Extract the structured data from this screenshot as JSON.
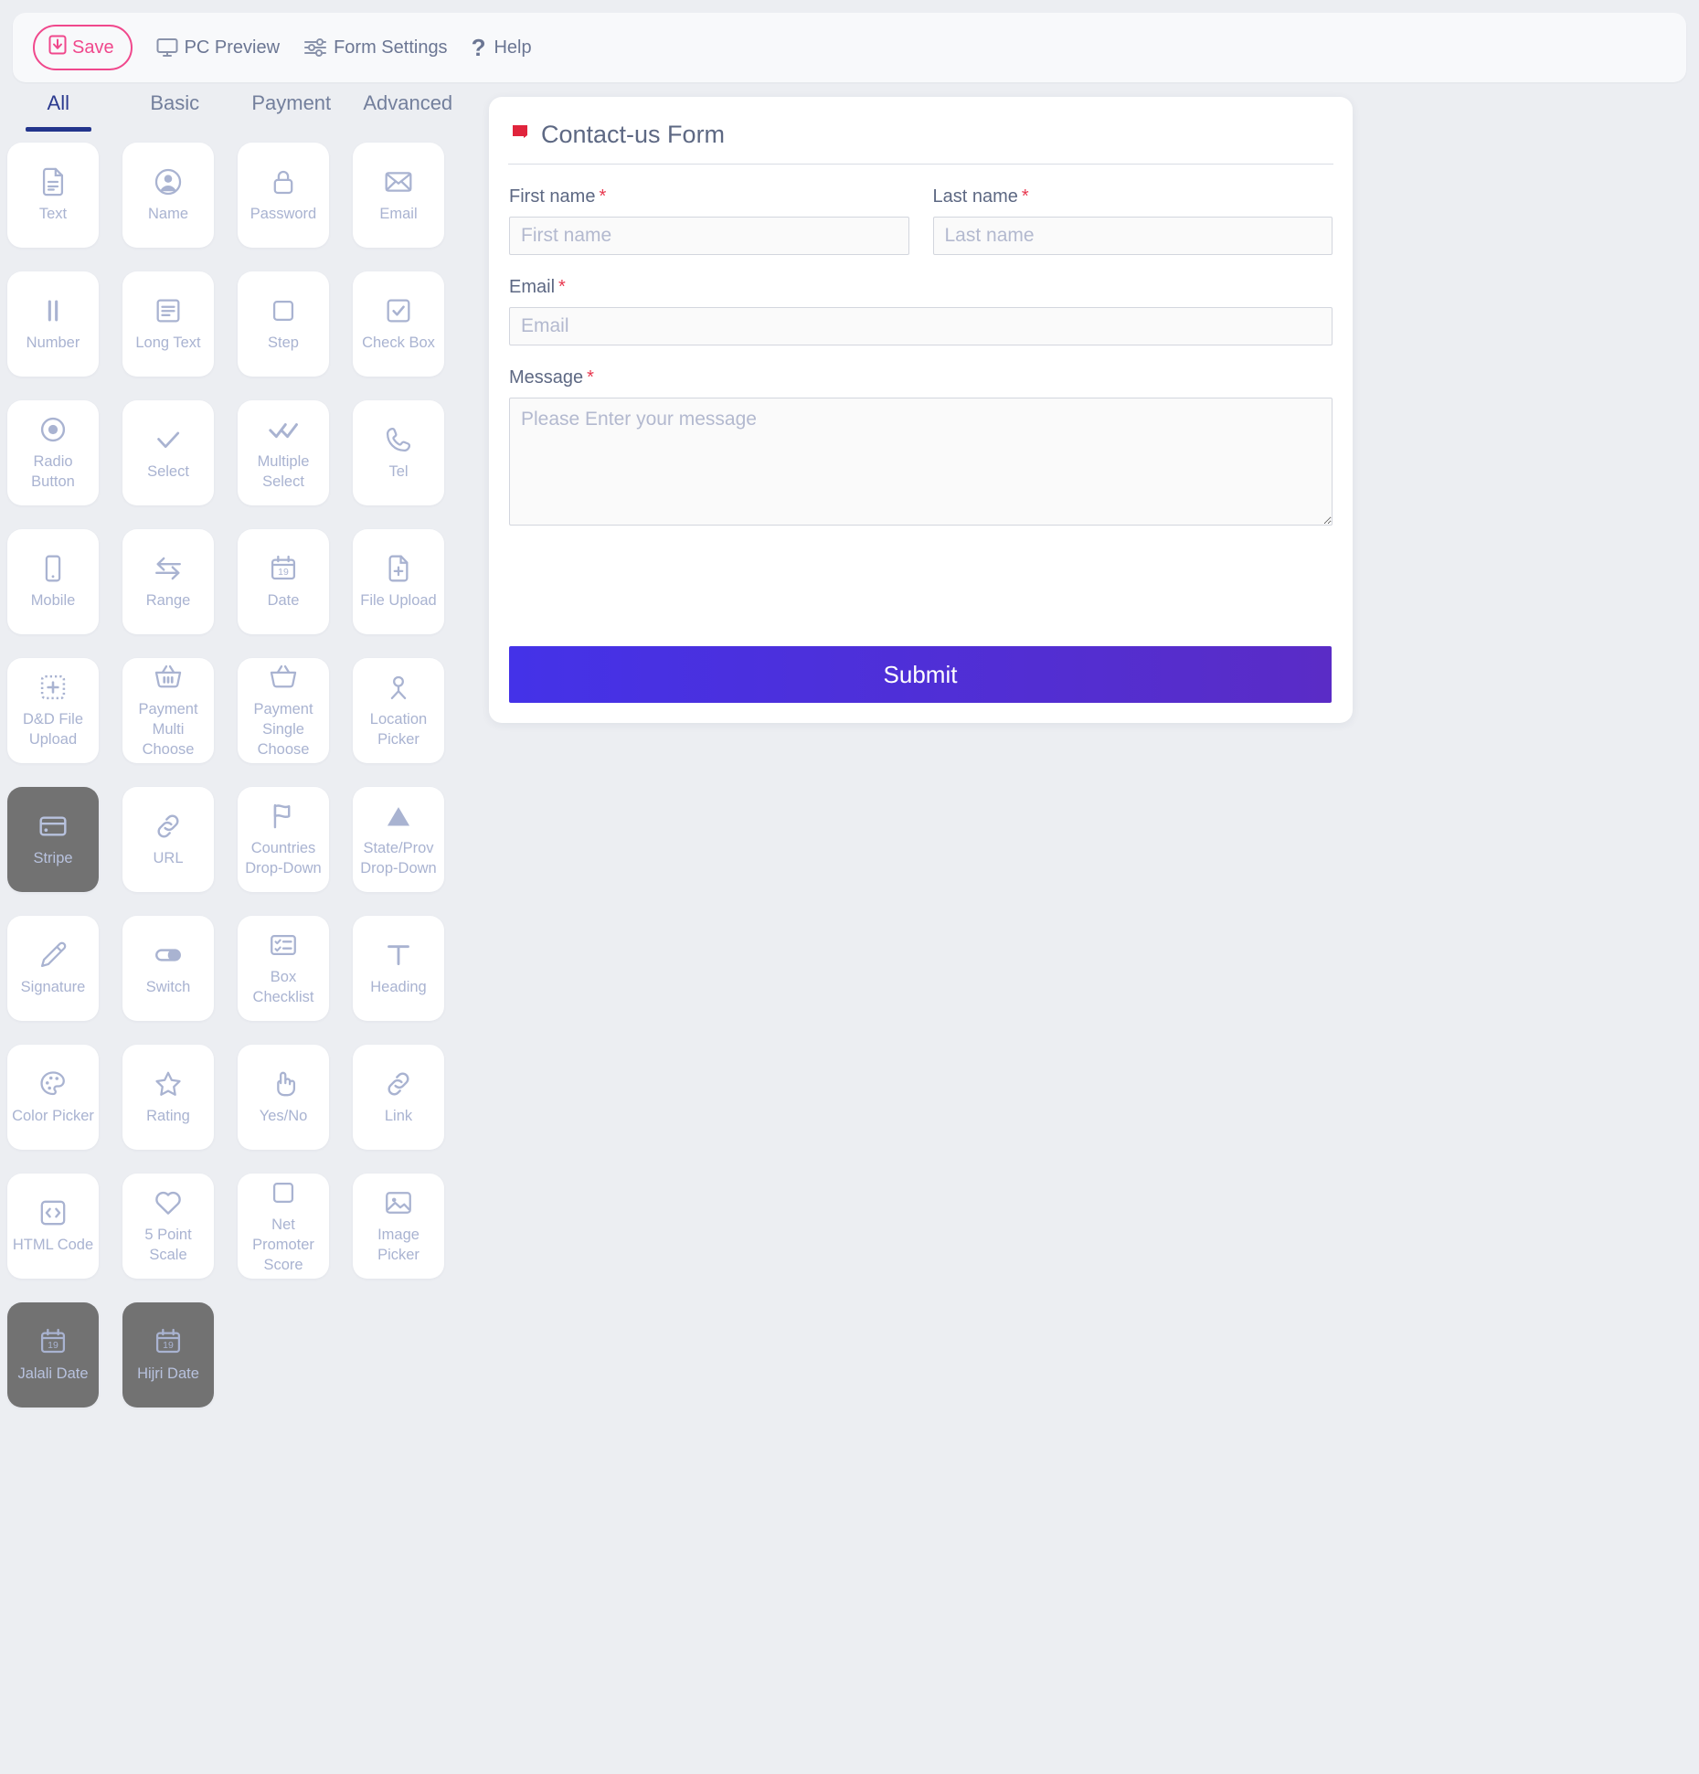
{
  "toolbar": {
    "save_label": "Save",
    "pc_preview_label": "PC Preview",
    "form_settings_label": "Form Settings",
    "help_label": "Help",
    "save_color": "#f0488c",
    "text_color": "#6b7693"
  },
  "tabs": {
    "active": "All",
    "accent": "#23358c",
    "items": [
      {
        "label": "All"
      },
      {
        "label": "Basic"
      },
      {
        "label": "Payment"
      },
      {
        "label": "Advanced"
      }
    ]
  },
  "palette": {
    "items": [
      {
        "label": "Text",
        "icon": "document-icon",
        "state": "normal"
      },
      {
        "label": "Name",
        "icon": "user-circle-icon",
        "state": "normal"
      },
      {
        "label": "Password",
        "icon": "lock-icon",
        "state": "normal"
      },
      {
        "label": "Email",
        "icon": "envelope-icon",
        "state": "normal"
      },
      {
        "label": "Number",
        "icon": "number-bars-icon",
        "state": "normal"
      },
      {
        "label": "Long Text",
        "icon": "text-lines-icon",
        "state": "normal"
      },
      {
        "label": "Step",
        "icon": "square-outline-icon",
        "state": "normal"
      },
      {
        "label": "Check Box",
        "icon": "checkbox-checked-icon",
        "state": "normal"
      },
      {
        "label": "Radio Button",
        "icon": "radio-button-icon",
        "state": "normal"
      },
      {
        "label": "Select",
        "icon": "check-icon",
        "state": "normal"
      },
      {
        "label": "Multiple Select",
        "icon": "double-check-icon",
        "state": "normal"
      },
      {
        "label": "Tel",
        "icon": "phone-icon",
        "state": "normal"
      },
      {
        "label": "Mobile",
        "icon": "mobile-phone-icon",
        "state": "normal"
      },
      {
        "label": "Range",
        "icon": "arrows-left-right-icon",
        "state": "normal"
      },
      {
        "label": "Date",
        "icon": "calendar-19-icon",
        "state": "normal"
      },
      {
        "label": "File Upload",
        "icon": "file-plus-icon",
        "state": "normal"
      },
      {
        "label": "D&D File Upload",
        "icon": "dashed-plus-icon",
        "state": "normal"
      },
      {
        "label": "Payment Multi Choose",
        "icon": "basket-filled-icon",
        "state": "normal"
      },
      {
        "label": "Payment Single Choose",
        "icon": "basket-empty-icon",
        "state": "normal"
      },
      {
        "label": "Location Picker",
        "icon": "location-pin-icon",
        "state": "normal"
      },
      {
        "label": "Stripe",
        "icon": "credit-card-icon",
        "state": "dark"
      },
      {
        "label": "URL",
        "icon": "link-chain-icon",
        "state": "normal"
      },
      {
        "label": "Countries Drop-Down",
        "icon": "flag-icon",
        "state": "normal"
      },
      {
        "label": "State/Prov Drop-Down",
        "icon": "triangle-icon",
        "state": "normal"
      },
      {
        "label": "Signature",
        "icon": "pen-icon",
        "state": "normal"
      },
      {
        "label": "Switch",
        "icon": "toggle-switch-icon",
        "state": "normal"
      },
      {
        "label": "Box Checklist",
        "icon": "checklist-box-icon",
        "state": "normal"
      },
      {
        "label": "Heading",
        "icon": "letter-t-icon",
        "state": "normal"
      },
      {
        "label": "Color Picker",
        "icon": "palette-icon",
        "state": "normal"
      },
      {
        "label": "Rating",
        "icon": "star-outline-icon",
        "state": "normal"
      },
      {
        "label": "Yes/No",
        "icon": "pointing-hand-icon",
        "state": "normal"
      },
      {
        "label": "Link",
        "icon": "link-chain-icon",
        "state": "normal"
      },
      {
        "label": "HTML Code",
        "icon": "code-brackets-icon",
        "state": "normal"
      },
      {
        "label": "5 Point Scale",
        "icon": "heart-outline-icon",
        "state": "normal"
      },
      {
        "label": "Net Promoter Score",
        "icon": "square-outline-icon",
        "state": "normal"
      },
      {
        "label": "Image Picker",
        "icon": "image-icon",
        "state": "normal"
      },
      {
        "label": "Jalali Date",
        "icon": "calendar-19-icon",
        "state": "dark"
      },
      {
        "label": "Hijri Date",
        "icon": "calendar-19-icon",
        "state": "dark"
      }
    ]
  },
  "form": {
    "title": "Contact-us Form",
    "title_icon": "red-flag-icon",
    "required_mark": "*",
    "fields": {
      "first_name": {
        "label": "First name",
        "placeholder": "First name",
        "value": ""
      },
      "last_name": {
        "label": "Last name",
        "placeholder": "Last name",
        "value": ""
      },
      "email": {
        "label": "Email",
        "placeholder": "Email",
        "value": ""
      },
      "message": {
        "label": "Message",
        "placeholder": "Please Enter your message",
        "value": ""
      }
    },
    "submit_label": "Submit",
    "submit_gradient_from": "#4432e8",
    "submit_gradient_to": "#5a2cc6"
  }
}
